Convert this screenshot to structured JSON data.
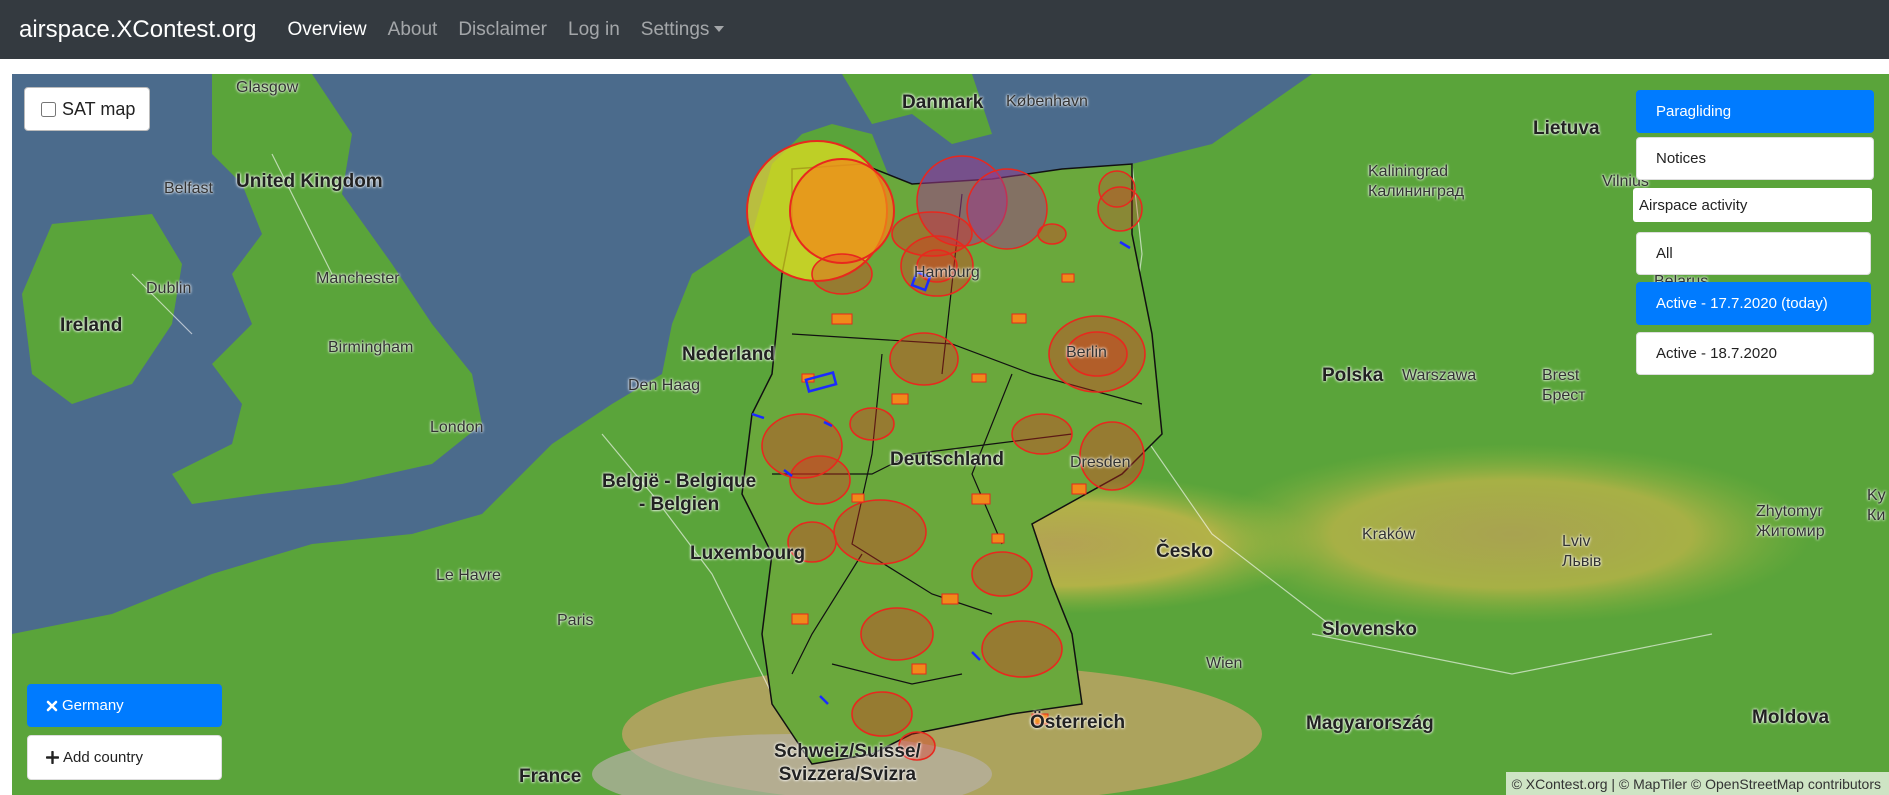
{
  "navbar": {
    "brand": "airspace.XContest.org",
    "links": [
      "Overview",
      "About",
      "Disclaimer",
      "Log in",
      "Settings"
    ]
  },
  "map": {
    "countries": {
      "danmark": "Danmark",
      "lietuva": "Lietuva",
      "uk": "United Kingdom",
      "ireland": "Ireland",
      "nederland": "Nederland",
      "polska": "Polska",
      "belgie_line1": "België - Belgique",
      "belgie_line2": "- Belgien",
      "deutschland": "Deutschland",
      "luxembourg": "Luxembourg",
      "cesko": "Česko",
      "slovensko": "Slovensko",
      "osterreich": "Österreich",
      "magyarorszag": "Magyarország",
      "moldova": "Moldova",
      "france": "France",
      "schweiz_line1": "Schweiz/Suisse/",
      "schweiz_line2": "Svizzera/Svizra"
    },
    "cities": {
      "glasgow": "Glasgow",
      "kobenhavn": "København",
      "belfast": "Belfast",
      "kaliningrad_line1": "Kaliningrad",
      "kaliningrad_line2": "Калининград",
      "vilnius": "Vilnius",
      "dublin": "Dublin",
      "manchester": "Manchester",
      "hamburg": "Hamburg",
      "birmingham": "Birmingham",
      "berlin": "Berlin",
      "den_haag": "Den Haag",
      "warszawa": "Warszawa",
      "brest_line1": "Brest",
      "brest_line2": "Брест",
      "london": "London",
      "dresden": "Dresden",
      "zhytomyr_line1": "Zhytomyr",
      "zhytomyr_line2": "Житомир",
      "krakow": "Kraków",
      "lviv_line1": "Lviv",
      "lviv_line2": "Львів",
      "le_havre": "Le Havre",
      "paris": "Paris",
      "wien": "Wien",
      "belarus_partial": "Belarus",
      "ky_partial_line1": "Ky",
      "ky_partial_line2": "Ки"
    },
    "attribution": "© XContest.org | © MapTiler © OpenStreetMap contributors"
  },
  "controls": {
    "sat_map_label": "SAT map",
    "sat_map_checked": false,
    "paragliding_label": "Paragliding",
    "notices_label": "Notices",
    "airspace_activity_label": "Airspace activity",
    "all_label": "All",
    "active_today_label": "Active - 17.7.2020 (today)",
    "active_tomorrow_label": "Active - 18.7.2020",
    "germany_label": "Germany",
    "add_country_label": "Add country"
  },
  "colors": {
    "navbar": "#343a40",
    "primary": "#007bff",
    "sea": "#4b6b8c",
    "land": "#5aa43a",
    "airspace": "#e8281e"
  },
  "icons": {
    "remove_country": "times-icon",
    "add_country": "plus-icon",
    "settings_dropdown": "caret-down-icon"
  }
}
